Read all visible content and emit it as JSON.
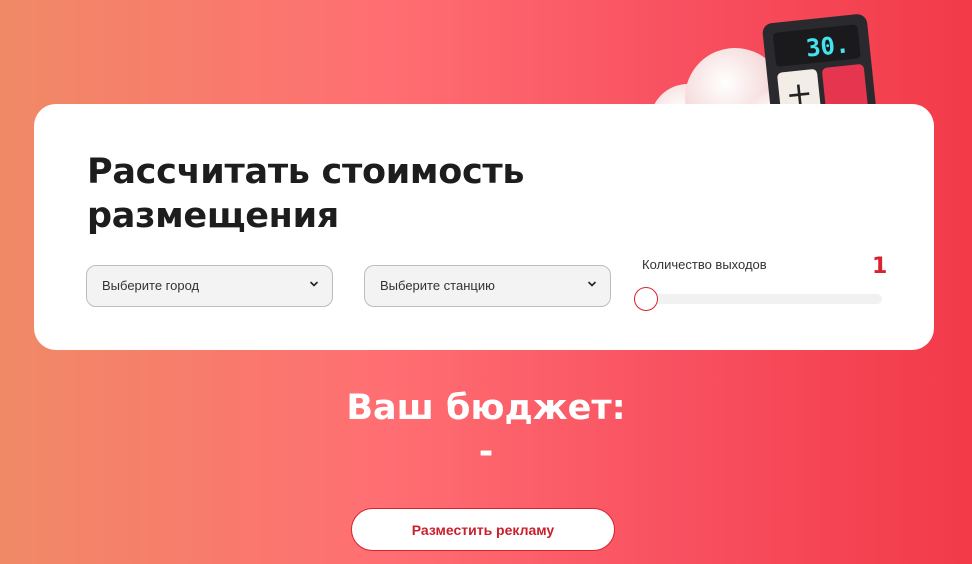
{
  "calculator": {
    "title_line1": "Рассчитать стоимость",
    "title_line2": "размещения",
    "city_select": {
      "selected": "Выберите город"
    },
    "station_select": {
      "selected": "Выберите станцию"
    },
    "exits": {
      "label": "Количество выходов",
      "value": "1",
      "level": 0
    }
  },
  "budget": {
    "label": "Ваш бюджет:",
    "value": "-"
  },
  "cta": {
    "label": "Разместить рекламу"
  },
  "decoration": {
    "display_text": "30.",
    "icon": "calculator-icon"
  },
  "colors": {
    "accent": "#d8222f",
    "card": "#ffffff",
    "text": "#1d1d1d"
  }
}
